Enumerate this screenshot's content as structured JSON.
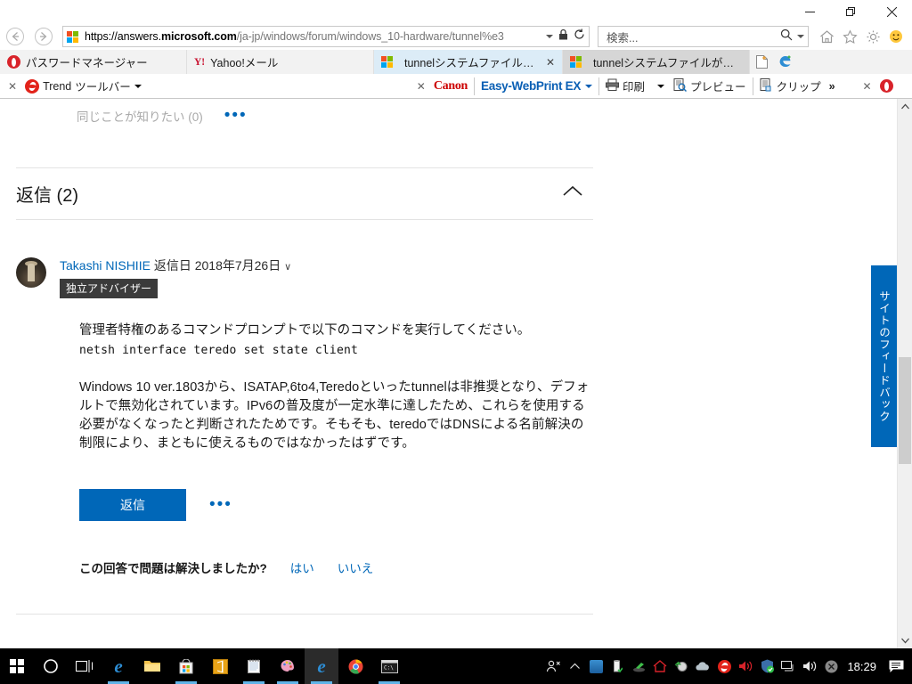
{
  "window": {
    "minimize_label": "—",
    "restore_label": "❐",
    "close_label": "✕"
  },
  "address_bar": {
    "back_label": "back-arrow",
    "forward_label": "forward-arrow",
    "url_prefix": "https://answers.",
    "url_domain": "microsoft.com",
    "url_path": "/ja-jp/windows/forum/windows_10-hardware/tunnel%e3",
    "lock_icon": "🔒",
    "refresh_icon": "↻",
    "search_placeholder": "検索...",
    "search_icon": "🔍",
    "home_icon": "home-icon",
    "favorites_icon": "star-icon",
    "settings_icon": "gear-icon",
    "feedback_icon": "smiley-icon"
  },
  "tabs": [
    {
      "title": "パスワードマネージャー",
      "icon": "opera-icon",
      "active": false,
      "closable": false
    },
    {
      "title": "Yahoo!メール",
      "icon": "yahoo-icon",
      "active": false,
      "closable": false
    },
    {
      "title": "tunnelシステムファイルが見つか...",
      "icon": "ms-icon",
      "active": true,
      "closable": true,
      "close_label": "✕"
    },
    {
      "title": "tunnelシステムファイルが見つかり...",
      "icon": "ms-icon",
      "active": false,
      "closable": false
    }
  ],
  "tabbar_extras": {
    "new_tab_label": "new-tab-icon",
    "edge_icon_label": "edge-icon"
  },
  "addon_toolbar": {
    "close_trend": "✕",
    "trend_label": "Trend",
    "trend_sub": "ツールバー",
    "close_canon": "✕",
    "canon_label": "Canon",
    "ewp_label": "Easy-WebPrint EX",
    "print_label": "印刷",
    "preview_label": "プレビュー",
    "clip_label": "クリップ",
    "overflow_label": "»",
    "close_opera": "✕"
  },
  "content": {
    "same_question_label": "同じことが知りたい (0)",
    "same_question_more": "•••",
    "replies_heading": "返信 (2)",
    "collapse_icon": "∧",
    "reply": {
      "author": "Takashi NISHIIE",
      "meta": "返信日 2018年7月26日",
      "meta_chevron": "∨",
      "badge": "独立アドバイザー",
      "paragraph1": "管理者特権のあるコマンドプロンプトで以下のコマンドを実行してください。",
      "command": "netsh interface teredo set state client",
      "paragraph2": "Windows 10 ver.1803から、ISATAP,6to4,Teredoといったtunnelは非推奨となり、デフォルトで無効化されています。IPv6の普及度が一定水準に達したため、これらを使用する必要がなくなったと判断されたためです。そもそも、teredoではDNSによる名前解決の制限により、まともに使えるものではなかったはずです。",
      "reply_button": "返信",
      "more_dots": "•••",
      "solved_question": "この回答で問題は解決しましたか?",
      "solved_yes": "はい",
      "solved_no": "いいえ"
    },
    "feedback_tab": "サイトのフィードバック"
  },
  "scrollbar": {
    "up_arrow": "∧",
    "down_arrow": "∨"
  },
  "taskbar": {
    "start_label": "start-button",
    "cortana_label": "cortana-icon",
    "taskview_label": "task-view-icon",
    "apps": [
      {
        "name": "edge-taskbar-icon"
      },
      {
        "name": "file-explorer-icon"
      },
      {
        "name": "microsoft-store-icon"
      },
      {
        "name": "office-icon"
      },
      {
        "name": "notepad-icon"
      },
      {
        "name": "paint-icon"
      },
      {
        "name": "internet-explorer-icon"
      },
      {
        "name": "chrome-icon"
      },
      {
        "name": "command-prompt-icon"
      }
    ],
    "tray": [
      {
        "name": "people-icon"
      },
      {
        "name": "show-hidden-icons-chevron"
      },
      {
        "name": "network-share-icon"
      },
      {
        "name": "usb-eject-icon"
      },
      {
        "name": "green-tray-icon"
      },
      {
        "name": "red-home-icon"
      },
      {
        "name": "sync-icon"
      },
      {
        "name": "onedrive-icon"
      },
      {
        "name": "trend-micro-tray-icon"
      },
      {
        "name": "volume-speaker-icon"
      },
      {
        "name": "security-shield-icon"
      },
      {
        "name": "display-icon"
      },
      {
        "name": "volume-icon"
      },
      {
        "name": "close-tray-icon"
      }
    ],
    "clock": "18:29",
    "action_center_label": "action-center-icon"
  },
  "colors": {
    "accent_blue": "#0067b8",
    "tab_active": "#dcecf7",
    "taskbar_bg": "#000000"
  }
}
